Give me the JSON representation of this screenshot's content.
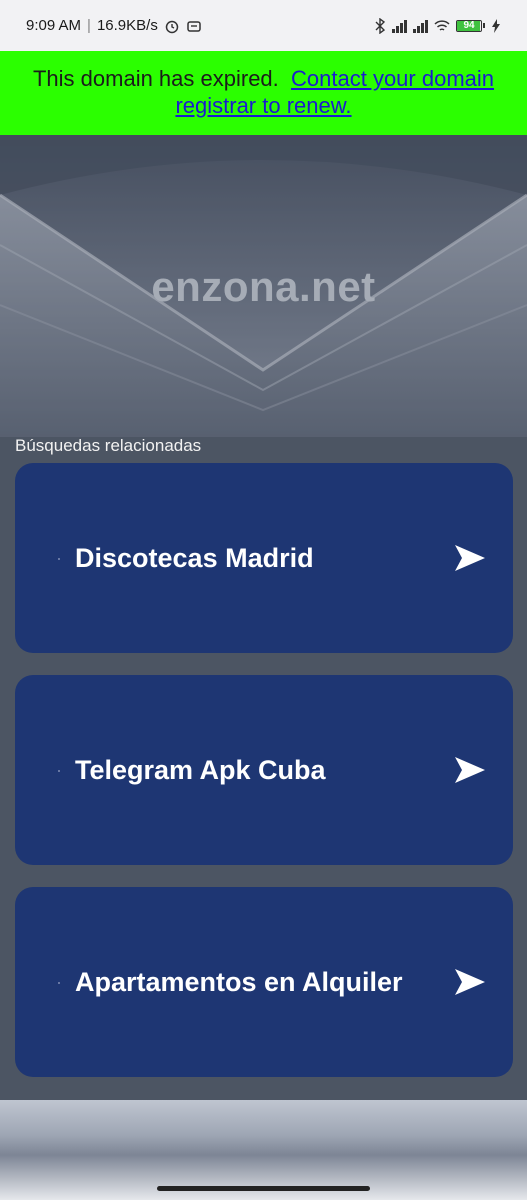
{
  "status_bar": {
    "time": "9:09 AM",
    "network_speed": "16.9KB/s",
    "battery_level": 94,
    "battery_text": "94"
  },
  "banner": {
    "text": "This domain has expired.",
    "link_text": "Contact your domain registrar to renew.",
    "background": "#2bff00"
  },
  "hero": {
    "title": "enzona.net"
  },
  "related": {
    "label": "Búsquedas relacionadas",
    "items": [
      {
        "label": "Discotecas Madrid"
      },
      {
        "label": "Telegram Apk Cuba"
      },
      {
        "label": "Apartamentos en Alquiler"
      }
    ]
  },
  "colors": {
    "card": "#1e3673",
    "page": "#4c5563"
  }
}
